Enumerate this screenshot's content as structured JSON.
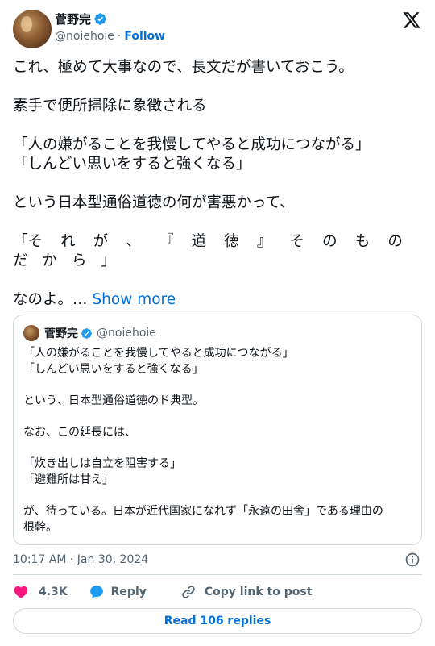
{
  "author": {
    "display_name": "菅野完",
    "handle": "@noiehoie",
    "separator": "·",
    "follow_label": "Follow"
  },
  "tweet": {
    "lines": [
      "これ、極めて大事なので、長文だが書いておこう。",
      "素手で便所掃除に象徴される",
      "「人の嫌がることを我慢してやると成功につながる」",
      "「しんどい思いをすると強くなる」",
      "という日本型通俗道徳の何が害悪かって、",
      "なのよ。…"
    ],
    "spaced_line_1": [
      "「そ",
      "れ",
      "が",
      "、",
      "『",
      "道",
      "徳",
      "』",
      "そ",
      "の",
      "も",
      "の"
    ],
    "spaced_line_2": [
      "だ",
      "か",
      "ら",
      "」"
    ],
    "show_more_label": "Show more"
  },
  "quote": {
    "display_name": "菅野完",
    "handle": "@noiehoie",
    "lines": [
      "「人の嫌がることを我慢してやると成功につながる」",
      "「しんどい思いをすると強くなる」",
      "という、日本型通俗道徳のド典型。",
      "なお、この延長には、",
      "「炊き出しは自立を阻害する」",
      "「避難所は甘え」",
      "が、待っている。日本が近代国家になれず「永遠の田舎」である理由の",
      "根幹。"
    ]
  },
  "meta": {
    "timestamp": "10:17 AM · Jan 30, 2024"
  },
  "actions": {
    "like_count": "4.3K",
    "reply_label": "Reply",
    "copy_label": "Copy link to post",
    "read_replies_label": "Read 106 replies"
  },
  "colors": {
    "accent": "#006fd6",
    "verified": "#1d9bf0",
    "like": "#f91880",
    "muted": "#536471",
    "border": "#cfd9de"
  },
  "icons": {
    "brand": "x-logo-icon",
    "verified": "verified-badge-icon",
    "info": "info-icon",
    "like": "heart-icon",
    "reply": "speech-bubble-icon",
    "copy": "link-icon"
  }
}
